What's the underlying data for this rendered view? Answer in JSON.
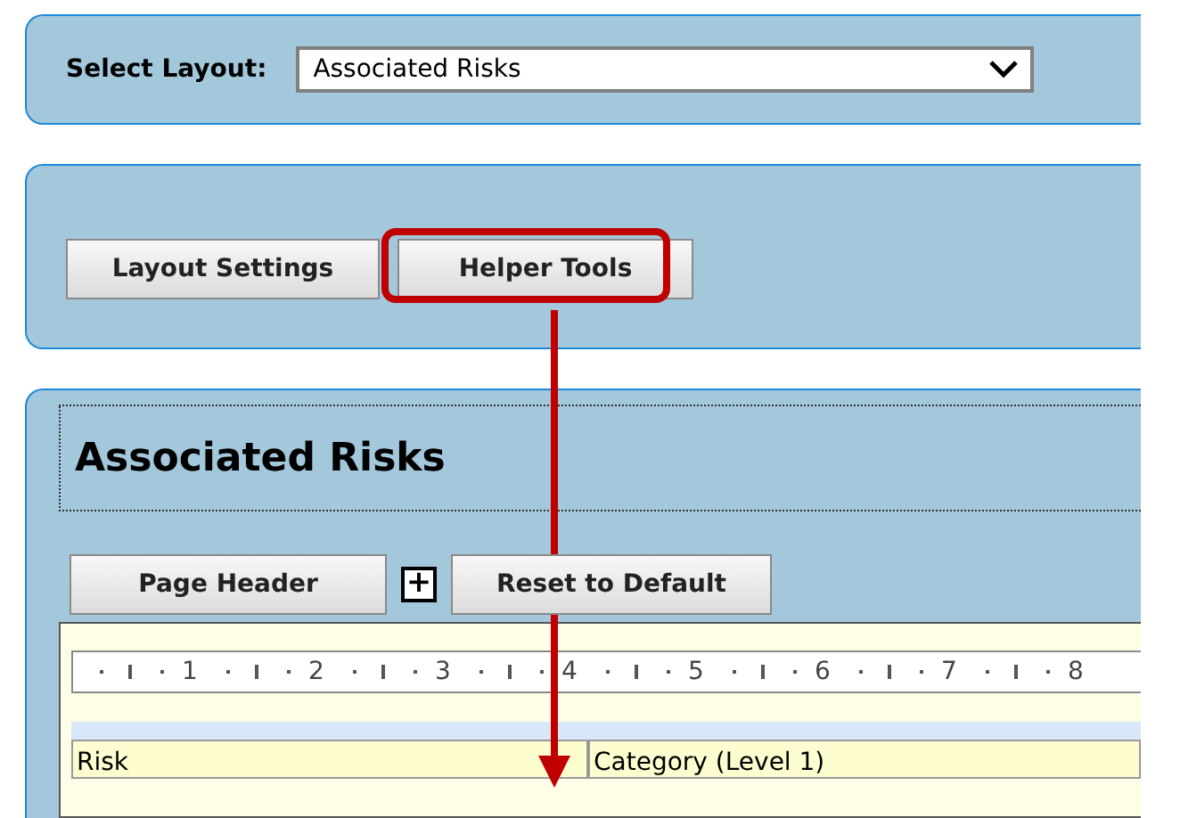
{
  "layout_select": {
    "label": "Select Layout:",
    "value": "Associated Risks"
  },
  "tool_buttons": [
    {
      "label": "Layout Settings",
      "highlighted": false
    },
    {
      "label": "Helper Tools",
      "highlighted": true
    }
  ],
  "section": {
    "title": "Associated Risks",
    "header_button": "Page Header",
    "expand_icon": "+",
    "reset_button": "Reset to Default",
    "ruler": [
      "1",
      "2",
      "3",
      "4",
      "5",
      "6",
      "7",
      "8"
    ],
    "columns": [
      "Risk",
      "Category (Level 1)"
    ]
  }
}
